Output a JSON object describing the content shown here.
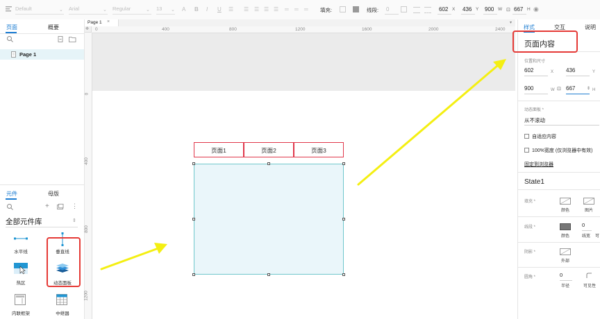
{
  "toolbar": {
    "style_value": "Default",
    "font_value": "Arial",
    "weight_value": "Regular",
    "size_value": "13",
    "fill_label": "填充:",
    "stroke_label": "线段:",
    "stroke_value": "0",
    "x_value": "602",
    "x_label": "X",
    "y_value": "436",
    "y_label": "Y",
    "w_value": "900",
    "w_label": "W",
    "h_value": "667",
    "h_label": "H"
  },
  "left_panel": {
    "tabs": [
      "页面",
      "概要"
    ],
    "pages": [
      {
        "label": "Page 1"
      }
    ],
    "library_tabs": [
      "元件",
      "母版"
    ],
    "library_name": "全部元件库",
    "widgets": [
      {
        "label": "水平线",
        "icon": "horizontal-line-icon"
      },
      {
        "label": "垂直线",
        "icon": "vertical-line-icon"
      },
      {
        "label": "热区",
        "icon": "hotspot-icon"
      },
      {
        "label": "动态面板",
        "icon": "dynamic-panel-icon"
      },
      {
        "label": "内联框架",
        "icon": "inline-frame-icon"
      },
      {
        "label": "中继器",
        "icon": "repeater-icon"
      }
    ]
  },
  "canvas": {
    "doc_tab": "Page 1",
    "ruler_h": [
      "0",
      "400",
      "800",
      "1200",
      "1600",
      "2000",
      "2400"
    ],
    "ruler_v": [
      "0",
      "400",
      "800",
      "1200"
    ],
    "page_tabs": [
      "页面1",
      "页面2",
      "页面3"
    ]
  },
  "right_panel": {
    "tabs": [
      "样式",
      "交互",
      "说明"
    ],
    "widget_name": "页面内容",
    "position_label": "位置和尺寸",
    "x_value": "602",
    "x_label": "X",
    "y_value": "436",
    "y_label": "Y",
    "w_value": "900",
    "w_label": "W",
    "h_value": "667",
    "h_label": "H",
    "dynamic_panel_label": "动态面板 *",
    "scroll_value": "从不滚动",
    "fit_content_label": "自适应内容",
    "full_width_label": "100%宽度 (仅浏览器中有效)",
    "pin_link": "固定到浏览器",
    "state_name": "State1",
    "fill_label": "填充 *",
    "fill_color_label": "颜色",
    "fill_image_label": "图片",
    "stroke_label": "线段 *",
    "stroke_color_label": "颜色",
    "stroke_width_value": "0",
    "stroke_width_label": "线宽",
    "stroke_visibility_label": "可",
    "shadow_label": "阴影 *",
    "shadow_outer_label": "外部",
    "corner_label": "圆角 *",
    "corner_radius_value": "0",
    "corner_radius_label": "半径",
    "corner_visibility_label": "可见性"
  },
  "colors": {
    "accent": "#1a7bd1",
    "annotation_red": "#e53935",
    "arrow_yellow": "#f4ef12",
    "panel_fill": "#eaf6fa",
    "panel_border": "#6fc7cc",
    "tab_border": "#e0364a",
    "gray_band": "#ebebeb"
  }
}
